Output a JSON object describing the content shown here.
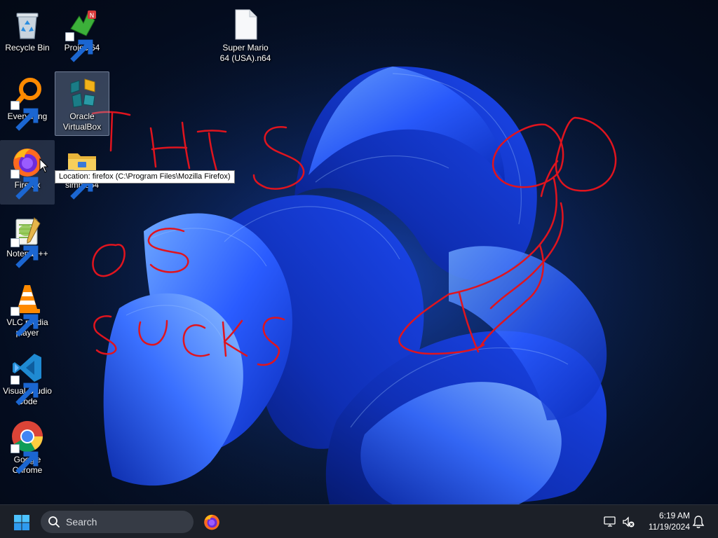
{
  "desktop": {
    "icons": [
      {
        "label": "Recycle Bin",
        "icon": "recycle-bin-icon"
      },
      {
        "label": "Project64",
        "icon": "project64-icon"
      },
      {
        "label": "Super Mario 64 (USA).n64",
        "icon": "file-icon"
      },
      {
        "label": "Everything",
        "icon": "everything-search-icon"
      },
      {
        "label": "Oracle VirtualBox",
        "icon": "virtualbox-icon"
      },
      {
        "label": "Firefox",
        "icon": "firefox-icon"
      },
      {
        "label": "simple64",
        "icon": "folder-icon"
      },
      {
        "label": "Notepad++",
        "icon": "notepad-plus-plus-icon"
      },
      {
        "label": "VLC media player",
        "icon": "vlc-cone-icon"
      },
      {
        "label": "Visual Studio Code",
        "icon": "vscode-icon"
      },
      {
        "label": "Google Chrome",
        "icon": "chrome-icon"
      }
    ],
    "tooltip": "Location: firefox (C:\\Program Files\\Mozilla Firefox)",
    "scribble_color": "#e0141e"
  },
  "taskbar": {
    "search_placeholder": "Search",
    "time": "6:19 AM",
    "date": "11/19/2024",
    "pinned": [
      "firefox-icon"
    ]
  }
}
